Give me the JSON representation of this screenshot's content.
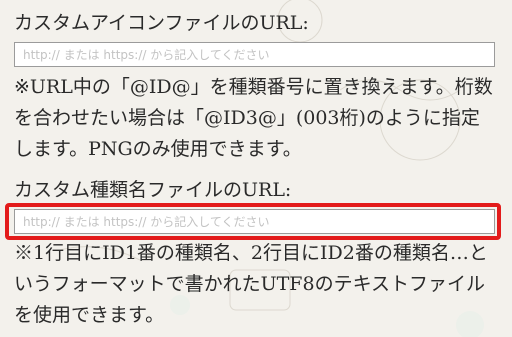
{
  "icon_section": {
    "label": "カスタムアイコンファイルのURL:",
    "input": {
      "value": "",
      "placeholder": "http:// または https:// から記入してください"
    },
    "note_lines": [
      "※URL中の「@ID@」を種類番号に置き換えます。桁数",
      "を合わせたい場合は「@ID3@」(003桁)のように指定",
      "します。PNGのみ使用できます。"
    ]
  },
  "name_section": {
    "label": "カスタム種類名ファイルのURL:",
    "input": {
      "value": "",
      "placeholder": "http:// または https:// から記入してください"
    },
    "note_lines": [
      "※1行目にID1番の種類名、2行目にID2番の種類名…と",
      "いうフォーマットで書かれたUTF8のテキストファイル",
      "を使用できます。"
    ]
  },
  "colors": {
    "highlight": "#e31b1b",
    "background": "#f3f1ec"
  }
}
